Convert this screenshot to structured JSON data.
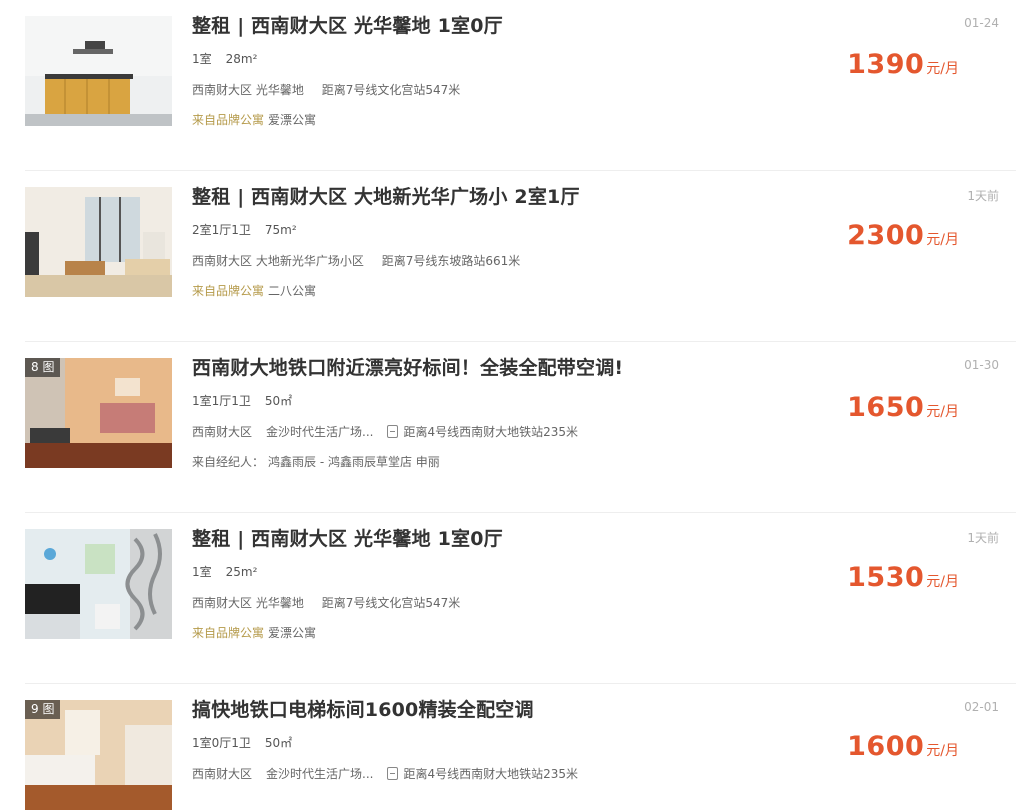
{
  "listings": [
    {
      "title": "整租 | 西南财大区 光华馨地 1室0厅",
      "specs": [
        "1室",
        "28m²"
      ],
      "area": "西南财大区",
      "place": "光华馨地",
      "distance": "距离7号线文化宫站547米",
      "source_label": "来自品牌公寓",
      "source_name": "爱漂公寓",
      "date": "01-24",
      "price": "1390",
      "unit": "元/月",
      "badge": ""
    },
    {
      "title": "整租 | 西南财大区 大地新光华广场小 2室1厅",
      "specs": [
        "2室1厅1卫",
        "75m²"
      ],
      "area": "西南财大区",
      "place": "大地新光华广场小区",
      "distance": "距离7号线东坡路站661米",
      "source_label": "来自品牌公寓",
      "source_name": "二八公寓",
      "date": "1天前",
      "price": "2300",
      "unit": "元/月",
      "badge": ""
    },
    {
      "title": "西南财大地铁口附近漂亮好标间！全装全配带空调!",
      "specs": [
        "1室1厅1卫",
        "50㎡"
      ],
      "area": "西南财大区",
      "place": "金沙时代生活广场...",
      "distance": "距离4号线西南财大地铁站235米",
      "source_label": "来自经纪人：",
      "source_name": "鸿鑫雨辰 - 鸿鑫雨辰草堂店 申丽",
      "date": "01-30",
      "price": "1650",
      "unit": "元/月",
      "badge": "8 图"
    },
    {
      "title": "整租 | 西南财大区 光华馨地 1室0厅",
      "specs": [
        "1室",
        "25m²"
      ],
      "area": "西南财大区",
      "place": "光华馨地",
      "distance": "距离7号线文化宫站547米",
      "source_label": "来自品牌公寓",
      "source_name": "爱漂公寓",
      "date": "1天前",
      "price": "1530",
      "unit": "元/月",
      "badge": ""
    },
    {
      "title": "搞快地铁口电梯标间1600精装全配空调",
      "specs": [
        "1室0厅1卫",
        "50㎡"
      ],
      "area": "西南财大区",
      "place": "金沙时代生活广场...",
      "distance": "距离4号线西南财大地铁站235米",
      "source_label": "",
      "source_name": "",
      "date": "02-01",
      "price": "1600",
      "unit": "元/月",
      "badge": "9 图"
    }
  ]
}
